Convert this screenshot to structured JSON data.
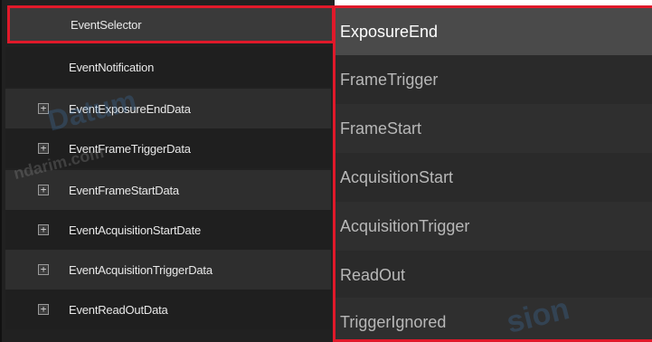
{
  "event_tree": {
    "items": [
      {
        "label": "EventSelector",
        "expandable": false,
        "selected": true
      },
      {
        "label": "EventNotification",
        "expandable": false,
        "selected": false
      },
      {
        "label": "EventExposureEndData",
        "expandable": true,
        "selected": false
      },
      {
        "label": "EventFrameTriggerData",
        "expandable": true,
        "selected": false
      },
      {
        "label": "EventFrameStartData",
        "expandable": true,
        "selected": false
      },
      {
        "label": "EventAcquisitionStartDate",
        "expandable": true,
        "selected": false
      },
      {
        "label": "EventAcquisitionTriggerData",
        "expandable": true,
        "selected": false
      },
      {
        "label": "EventReadOutData",
        "expandable": true,
        "selected": false
      }
    ],
    "expander_glyph": "+"
  },
  "event_dropdown": {
    "selected_value": "ExposureEnd",
    "options": [
      "ExposureEnd",
      "FrameTrigger",
      "FrameStart",
      "AcquisitionStart",
      "AcquisitionTrigger",
      "ReadOut",
      "TriggerIgnored"
    ]
  },
  "watermark": {
    "text_1": "Datum",
    "text_2": "ndarim.com",
    "text_3": "sion"
  },
  "colors": {
    "highlight_border": "#e0192a",
    "panel_bg": "#212121",
    "row_alt_bg": "#2e2e2e",
    "selected_bg": "#3a3a3a",
    "dropdown_bg": "#2a2a2a",
    "dropdown_current_bg": "#4a4a4a",
    "text_light": "#e8e8e8",
    "text_muted": "#b8b8b8"
  }
}
